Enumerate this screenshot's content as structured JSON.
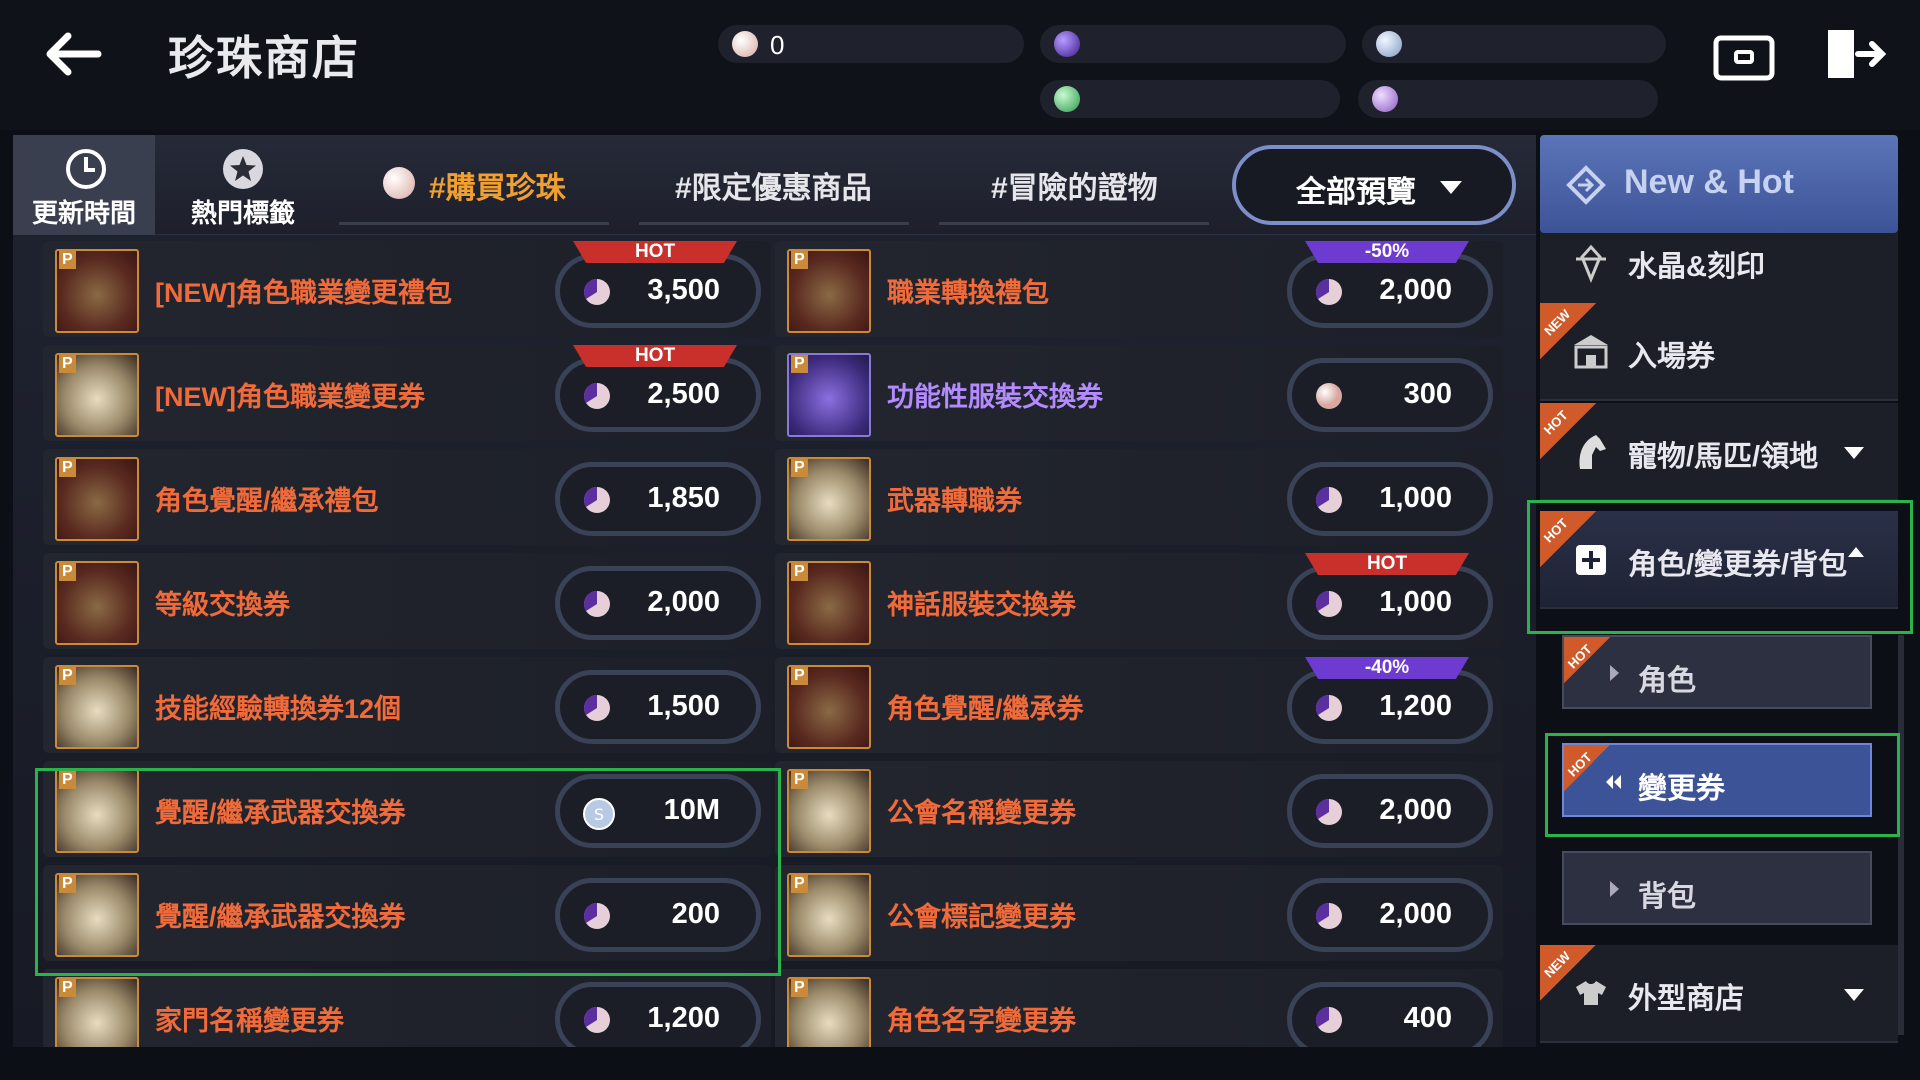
{
  "header": {
    "title": "珍珠商店",
    "currencies": [
      {
        "name": "pearl",
        "value": "0",
        "color": "#e8c8c0"
      },
      {
        "name": "purple-orb",
        "value": "",
        "color": "#6a3bd0"
      },
      {
        "name": "silver-s",
        "value": "",
        "color": "#9fb7d8"
      },
      {
        "name": "green-m",
        "value": "",
        "color": "#4fbf6a"
      },
      {
        "name": "purple-m",
        "value": "",
        "color": "#a27ad0"
      }
    ]
  },
  "tabs": {
    "update_time": "更新時間",
    "hot_tags": "熱門標籤",
    "categories": [
      {
        "label": "#購買珍珠",
        "active": true
      },
      {
        "label": "#限定優惠商品",
        "active": false
      },
      {
        "label": "#冒險的證物",
        "active": false
      }
    ],
    "dropdown": "全部預覽"
  },
  "items": [
    {
      "name": "[NEW]角色職業變更禮包",
      "price": "3,500",
      "badge": "HOT",
      "currency": "pearl-cut",
      "thumb": "chest"
    },
    {
      "name": "職業轉換禮包",
      "price": "2,000",
      "badge": "-50%",
      "currency": "pearl-cut",
      "thumb": "chest"
    },
    {
      "name": "[NEW]角色職業變更券",
      "price": "2,500",
      "badge": "HOT",
      "currency": "pearl-cut",
      "thumb": "paper"
    },
    {
      "name": "功能性服裝交換券",
      "price": "300",
      "badge": "",
      "currency": "pearl",
      "thumb": "blue",
      "purple": true
    },
    {
      "name": "角色覺醒/繼承禮包",
      "price": "1,850",
      "badge": "",
      "currency": "pearl-cut",
      "thumb": "chest"
    },
    {
      "name": "武器轉職券",
      "price": "1,000",
      "badge": "",
      "currency": "pearl-cut",
      "thumb": "paper"
    },
    {
      "name": "等級交換券",
      "price": "2,000",
      "badge": "",
      "currency": "pearl-cut",
      "thumb": "chest"
    },
    {
      "name": "神話服裝交換券",
      "price": "1,000",
      "badge": "HOT",
      "currency": "pearl-cut",
      "thumb": "chest"
    },
    {
      "name": "技能經驗轉換券12個",
      "price": "1,500",
      "badge": "",
      "currency": "pearl-cut",
      "thumb": "paper"
    },
    {
      "name": "角色覺醒/繼承券",
      "price": "1,200",
      "badge": "-40%",
      "currency": "pearl-cut",
      "thumb": "chest"
    },
    {
      "name": "覺醒/繼承武器交換券",
      "price": "10M",
      "badge": "",
      "currency": "silver",
      "thumb": "paper"
    },
    {
      "name": "公會名稱變更券",
      "price": "2,000",
      "badge": "",
      "currency": "pearl-cut",
      "thumb": "paper"
    },
    {
      "name": "覺醒/繼承武器交換券",
      "price": "200",
      "badge": "",
      "currency": "pearl-cut",
      "thumb": "paper"
    },
    {
      "name": "公會標記變更券",
      "price": "2,000",
      "badge": "",
      "currency": "pearl-cut",
      "thumb": "paper"
    },
    {
      "name": "家門名稱變更券",
      "price": "1,200",
      "badge": "",
      "currency": "pearl-cut",
      "thumb": "paper"
    },
    {
      "name": "角色名字變更券",
      "price": "400",
      "badge": "",
      "currency": "pearl-cut",
      "thumb": "paper"
    }
  ],
  "sidebar": {
    "new_hot": "New & Hot",
    "items": [
      {
        "label": "水晶&刻印",
        "tag": ""
      },
      {
        "label": "入場券",
        "tag": "NEW"
      },
      {
        "label": "寵物/馬匹/領地",
        "tag": "HOT",
        "expandable": true
      },
      {
        "label": "角色/變更券/背包",
        "tag": "HOT",
        "expanded": true
      },
      {
        "label": "外型商店",
        "tag": "NEW",
        "expandable": true
      }
    ],
    "subitems": [
      {
        "label": "角色",
        "tag": "HOT",
        "active": false
      },
      {
        "label": "變更券",
        "tag": "HOT",
        "active": true
      },
      {
        "label": "背包",
        "tag": "",
        "active": false
      }
    ]
  },
  "colors": {
    "accent": "#3d5397",
    "item_name": "#f06a3a",
    "highlight": "#29b34a",
    "hot_badge": "#c9302c",
    "discount_badge": "#6d3bd0"
  }
}
